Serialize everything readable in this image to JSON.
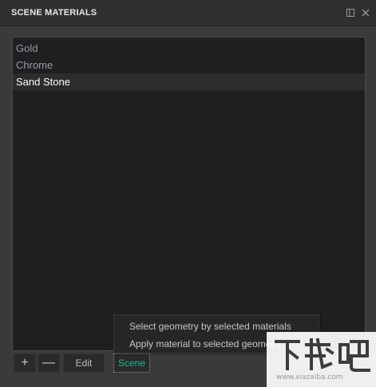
{
  "panel": {
    "title": "SCENE MATERIALS"
  },
  "materials": [
    {
      "label": "Gold",
      "selected": false
    },
    {
      "label": "Chrome",
      "selected": false
    },
    {
      "label": "Sand Stone",
      "selected": true
    }
  ],
  "toolbar": {
    "add_label": "+",
    "remove_label": "—",
    "edit_label": "Edit",
    "scene_label": "Scene"
  },
  "context_menu": {
    "items": [
      "Select geometry by selected materials",
      "Apply material to selected geometry"
    ]
  },
  "watermark": {
    "brand": "下载吧",
    "url": "www.xiazaiba.com"
  },
  "colors": {
    "accent": "#23b58a",
    "panel_bg": "#3a3a3c",
    "list_bg": "#1f1f21"
  },
  "icons": {
    "maximize": "maximize-icon",
    "close": "close-icon"
  }
}
